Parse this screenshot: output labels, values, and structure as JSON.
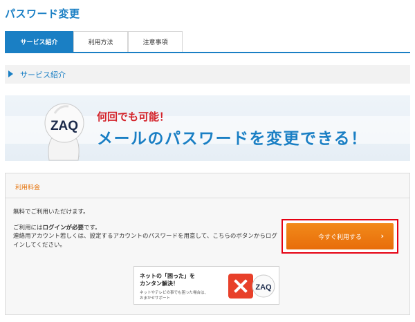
{
  "page": {
    "title": "パスワード変更"
  },
  "tabs": [
    {
      "label": "サービス紹介",
      "active": true
    },
    {
      "label": "利用方法",
      "active": false
    },
    {
      "label": "注意事項",
      "active": false
    }
  ],
  "section": {
    "label": "サービス紹介"
  },
  "banner": {
    "sub": "何回でも可能！",
    "main": "メールのパスワードを変更できる！",
    "mascot_text": "ZAQ"
  },
  "fee": {
    "title": "利用料金",
    "free_text": "無料でご利用いただけます。",
    "login_prefix": "ご利用には",
    "login_bold": "ログインが必要",
    "login_suffix": "です。",
    "detail": "連絡用アカウント若しくは、設定するアカウントのパスワードを用意して、こちらのボタンからログインしてください。"
  },
  "cta": {
    "label": "今すぐ利用する",
    "chevron": "›"
  },
  "ad": {
    "line1": "ネットの「困った」を",
    "line2": "カンタン解決！",
    "small1": "ネットやテレビの事でも困った場合は、",
    "small2": "おまかせサポート",
    "mascot_text": "ZAQ"
  },
  "colors": {
    "brand_blue": "#1a7fc4",
    "accent_orange": "#ee7d12",
    "highlight_red": "#e50012",
    "alert_red": "#d4232a"
  }
}
